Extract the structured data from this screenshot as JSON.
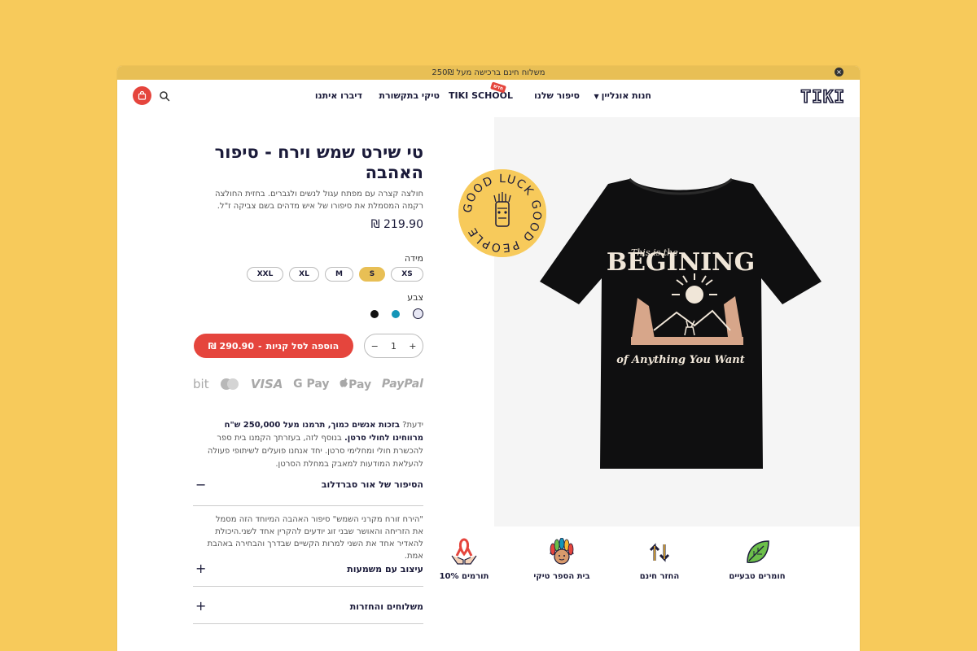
{
  "promo": {
    "text": "משלוח חינם ברכישה מעל 250₪"
  },
  "header": {
    "logo": "TIKI",
    "nav": {
      "shop": "חנות אונליין",
      "story": "סיפור שלנו",
      "school": "TIKI SCHOOL",
      "school_tag": "חדש",
      "media": "טיקי בתקשורת",
      "talk": "דיברו איתנו"
    }
  },
  "product": {
    "title": "טי שירט שמש וירח - סיפור האהבה",
    "description": "חולצה קצרה עם מפתח עגול לנשים ולגברים. בחזית החולצה רקמה המסמלת את סיפורו של איש מדהים בשם צביקה ז\"ל.",
    "price": "219.90 ₪",
    "size_label": "מידה",
    "sizes": [
      "XS",
      "S",
      "M",
      "XL",
      "XXL"
    ],
    "selected_size": "S",
    "color_label": "צבע",
    "colors": [
      "#e8e8f5",
      "#1395b8",
      "#111111"
    ],
    "quantity": "1",
    "qty_minus": "−",
    "qty_plus": "+",
    "add_button_label": "הוספה לסל קניות",
    "add_button_price": "290.90 ₪",
    "add_button_sep": "-",
    "shirt_print_top": "This is the",
    "shirt_print_main": "BEGINING",
    "shirt_print_bottom": "of Anything You Want"
  },
  "badge": {
    "text": "GOOD LUCK GOOD PEOPLE"
  },
  "payments": {
    "paypal": "PayPal",
    "applepay": "Pay",
    "gpay": "G Pay",
    "visa": "VISA",
    "bit": "bit"
  },
  "did_know": {
    "prefix": "ידעת? ",
    "bold": "בזכות אנשים כמוך, תרמנו מעל 250,000 ש\"ח מרווחינו לחולי סרטן.",
    "rest": " בנוסף לזה, בעזרתך הקמנו בית ספר להכשרת חולי ומחלימי סרטן. יחד אנחנו פועלים לשיתופי פעולה להעלאת המודעות למאבק במחלת הסרטן."
  },
  "accordions": [
    {
      "title": "הסיפור של אור סברדלוב",
      "sign": "−",
      "open": true,
      "body": "\"הירח זורח מקרני השמש\" סיפור האהבה המיוחד הזה מסמל את הזריחה והאושר שבני זוג יודעים להקרין אחד לשני.היכולת להאדיר אחד את השני למרות הקשיים שבדרך והבחירה באהבת אמת."
    },
    {
      "title": "עיצוב עם משמעות",
      "sign": "+",
      "open": false
    },
    {
      "title": "משלוחים והחזרות",
      "sign": "+",
      "open": false
    }
  ],
  "features": [
    {
      "label": "חומרים טבעיים",
      "icon": "leaf-icon"
    },
    {
      "label": "החזר חינם",
      "icon": "exchange-arrows-icon"
    },
    {
      "label": "בית הספר טיקי",
      "icon": "tiki-chief-icon"
    },
    {
      "label": "תורמים 10%",
      "icon": "ribbon-hands-icon"
    }
  ],
  "colors": {
    "accent_red": "#e5453d",
    "brand_yellow": "#f7ca5b",
    "navy": "#1b1b3a"
  }
}
